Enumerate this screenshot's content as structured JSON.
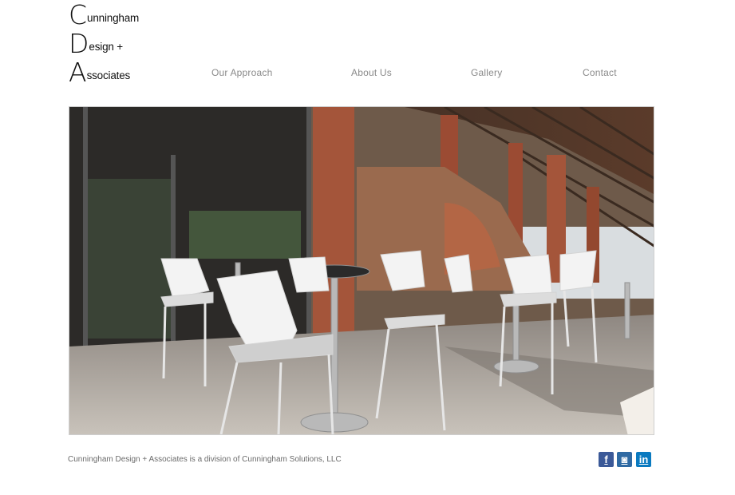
{
  "logo": {
    "line1": {
      "cap": "C",
      "rest": "unningham"
    },
    "line2": {
      "cap": "D",
      "rest": "esign  +"
    },
    "line3": {
      "cap": "A",
      "rest": "ssociates"
    }
  },
  "nav": {
    "items": [
      {
        "label": "Our Approach"
      },
      {
        "label": "About Us"
      },
      {
        "label": "Gallery"
      },
      {
        "label": "Contact"
      }
    ]
  },
  "hero": {
    "icon": "photo-cafe-terrace-icon"
  },
  "footer": {
    "text": "Cunningham Design + Associates is a division of Cunningham Solutions, LLC"
  },
  "social": [
    {
      "glyph": "f",
      "icon": "facebook-icon",
      "color": "#3b5998"
    },
    {
      "glyph": "◙",
      "icon": "instagram-icon",
      "color": "#2f6aa3"
    },
    {
      "glyph": "in",
      "icon": "linkedin-icon",
      "color": "#0a7ac0"
    }
  ]
}
